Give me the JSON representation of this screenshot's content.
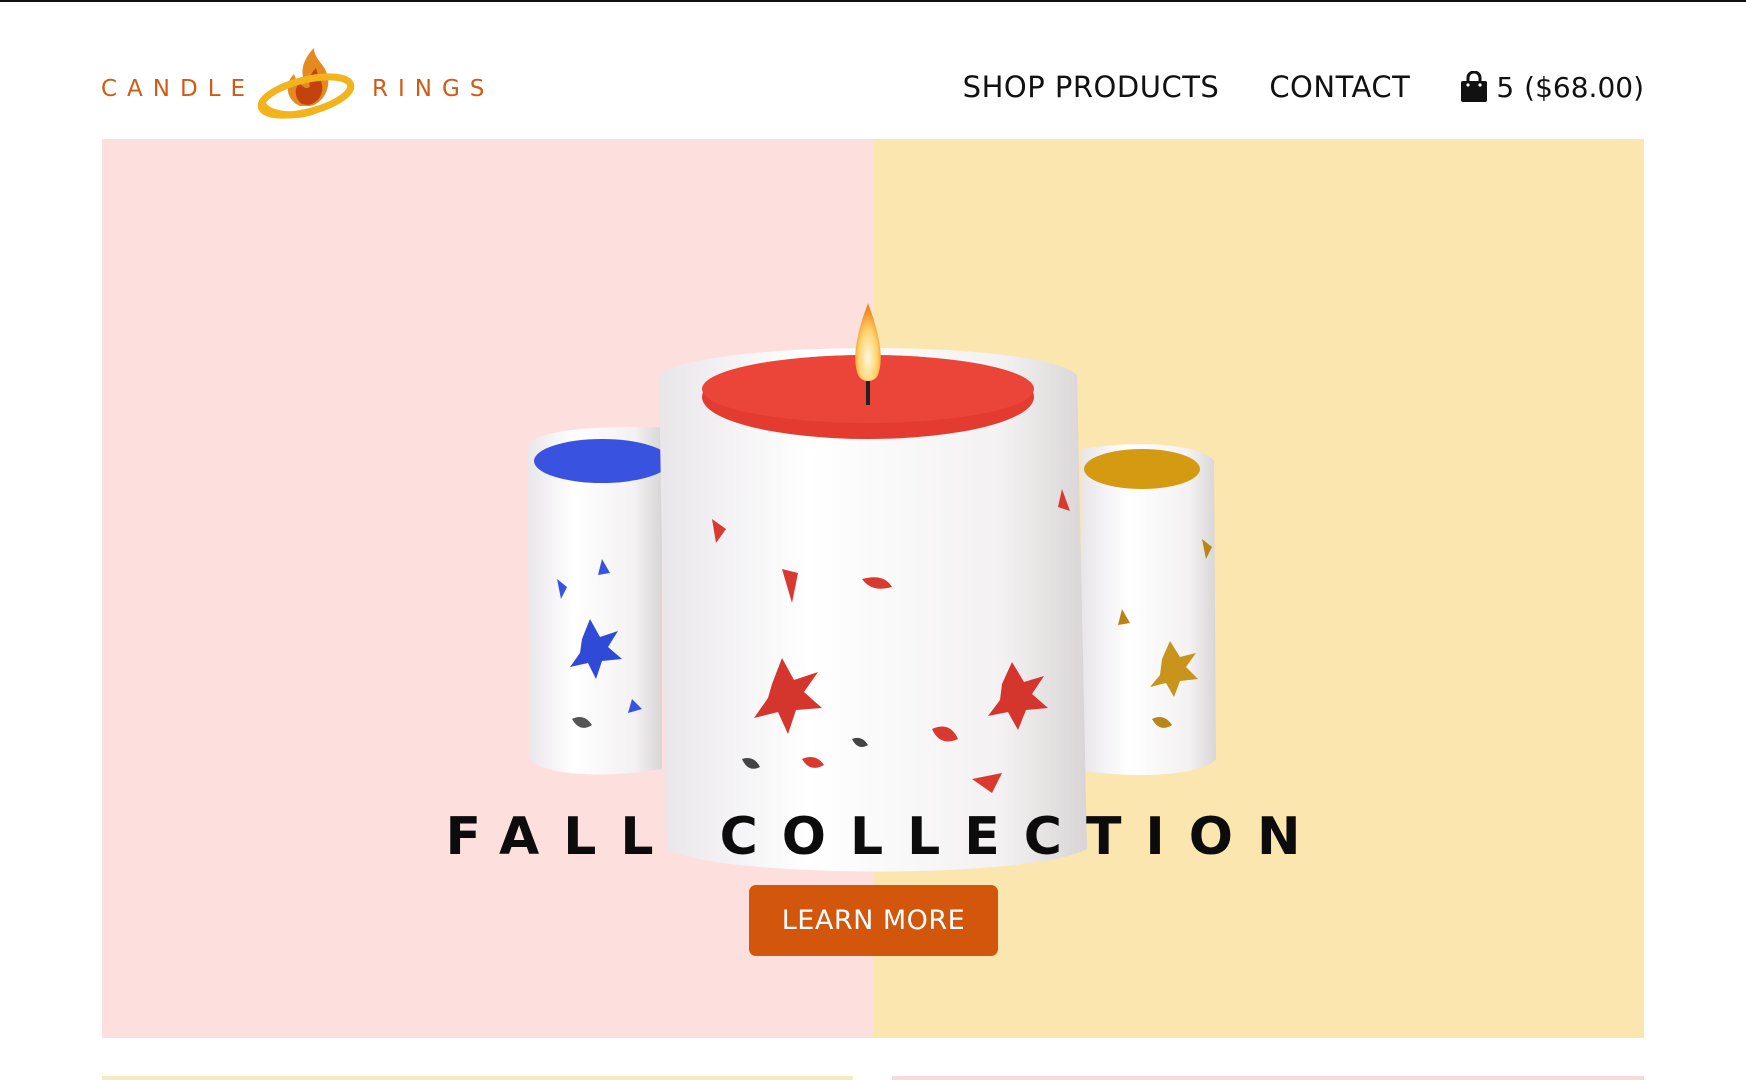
{
  "brand": {
    "word_left": "CANDLE",
    "word_right": "RINGS",
    "logo_icon": "flame-ring-logo",
    "color": "#d15a14"
  },
  "nav": {
    "shop_label": "SHOP PRODUCTS",
    "contact_label": "CONTACT",
    "cart_icon": "shopping-bag-icon",
    "cart_count": "5",
    "cart_total": "($68.00)"
  },
  "hero": {
    "title": "FALL COLLECTION",
    "cta_label": "LEARN MORE",
    "left_bg": "#fde0de",
    "right_bg": "#fae6ae",
    "cta_color": "#d2560c"
  }
}
